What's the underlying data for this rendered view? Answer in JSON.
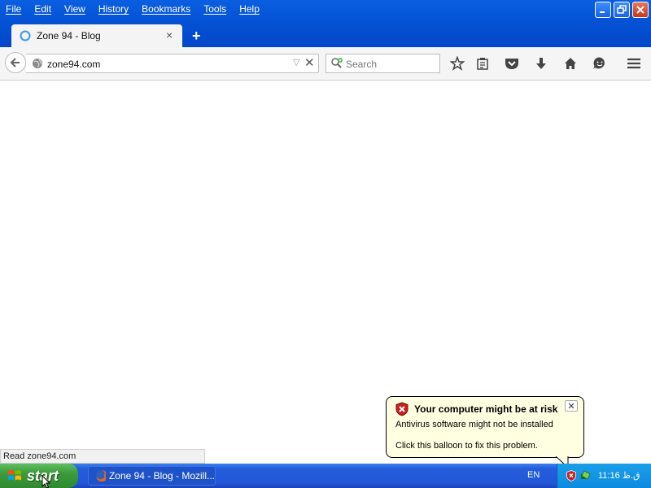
{
  "menu": [
    "File",
    "Edit",
    "View",
    "History",
    "Bookmarks",
    "Tools",
    "Help"
  ],
  "tab": {
    "title": "Zone 94 - Blog",
    "close": "×",
    "new_tab": "+"
  },
  "urlbar": {
    "value": "zone94.com"
  },
  "search": {
    "placeholder": "Search"
  },
  "status": {
    "text": "Read zone94.com"
  },
  "balloon": {
    "title": "Your computer might be at risk",
    "line1": "Antivirus software might not be installed",
    "line2": "Click this balloon to fix this problem.",
    "close": "✕"
  },
  "taskbar": {
    "start": "start",
    "window_button": "Zone 94 - Blog - Mozill...",
    "language": "EN",
    "clock": "11:16 ق.ظ"
  },
  "icons": {
    "toolbar": [
      "bookmark-star-icon",
      "reading-list-icon",
      "pocket-icon",
      "download-icon",
      "home-icon",
      "smiley-icon",
      "menu-icon"
    ]
  },
  "colors": {
    "title_blue": "#0553d6",
    "taskbar_blue": "#245ddb",
    "start_green": "#3c9a3c",
    "balloon_bg": "#ffffe1"
  }
}
